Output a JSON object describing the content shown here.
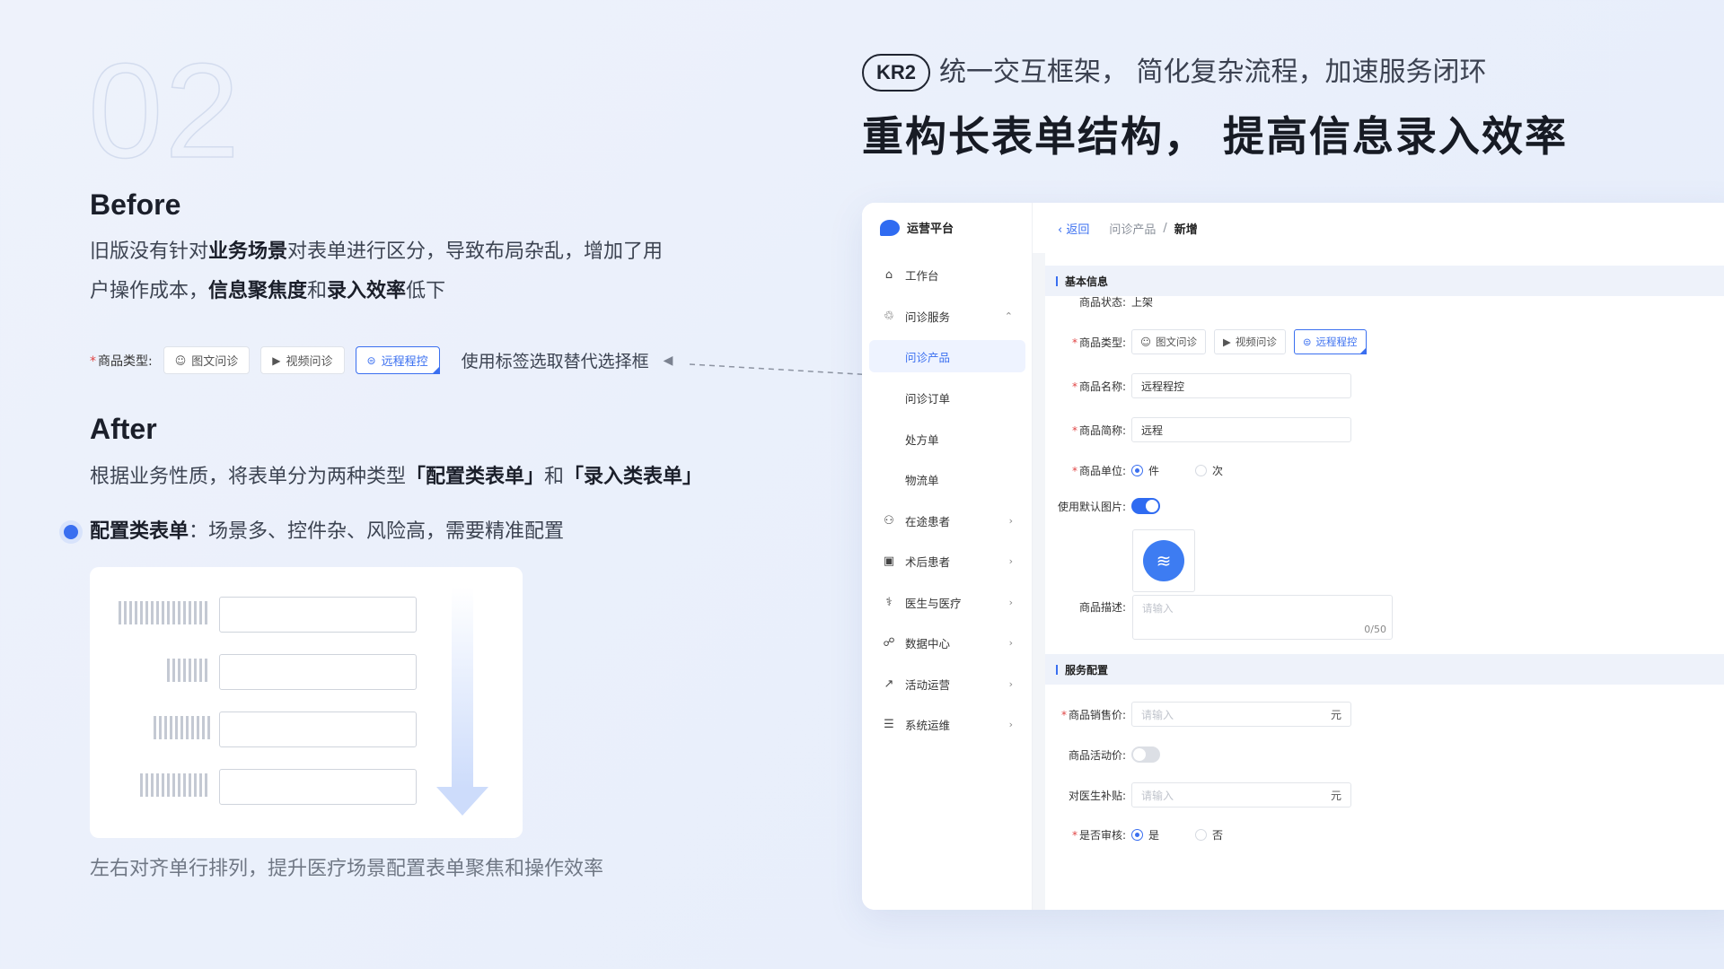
{
  "left": {
    "number": "02",
    "before": {
      "title": "Before",
      "line1_a": "旧版没有针对",
      "line1_b": "业务场景",
      "line1_c": "对表单进行区分，导致布局杂乱，增加了用",
      "line2_a": "户操作成本，",
      "line2_b": "信息聚焦度",
      "line2_c": "和",
      "line2_d": "录入效率",
      "line2_e": "低下"
    },
    "demo": {
      "label": "商品类型:",
      "tags": [
        "图文问诊",
        "视频问诊",
        "远程程控"
      ],
      "selected_index": 2,
      "note": "使用标签选取替代选择框"
    },
    "after": {
      "title": "After",
      "line_a": "根据业务性质，将表单分为两种类型",
      "line_b": "「配置类表单」",
      "line_c": "和",
      "line_d": "「录入类表单」"
    },
    "bullet": {
      "strong": "配置类表单",
      "text": "：场景多、控件杂、风险高，需要精准配置"
    },
    "caption": "左右对齐单行排列，提升医疗场景配置表单聚焦和操作效率"
  },
  "header": {
    "badge": "KR2",
    "subtitle": "统一交互框架，  简化复杂流程，加速服务闭环",
    "headline": "重构长表单结构，  提高信息录入效率"
  },
  "app": {
    "brand": "运营平台",
    "nav": [
      {
        "icon": "home-icon",
        "glyph": "⌂",
        "label": "工作台",
        "chevron": ""
      },
      {
        "icon": "service-icon",
        "glyph": "♲",
        "label": "问诊服务",
        "chevron": "⌃"
      },
      {
        "icon": "",
        "glyph": "",
        "label": "问诊产品",
        "chevron": "",
        "active": true
      },
      {
        "icon": "",
        "glyph": "",
        "label": "问诊订单",
        "chevron": ""
      },
      {
        "icon": "",
        "glyph": "",
        "label": "处方单",
        "chevron": ""
      },
      {
        "icon": "",
        "glyph": "",
        "label": "物流单",
        "chevron": ""
      },
      {
        "icon": "patients-icon",
        "glyph": "⚇",
        "label": "在途患者",
        "chevron": "›"
      },
      {
        "icon": "post-op-icon",
        "glyph": "▣",
        "label": "术后患者",
        "chevron": "›"
      },
      {
        "icon": "doctor-icon",
        "glyph": "⚕",
        "label": "医生与医疗",
        "chevron": "›"
      },
      {
        "icon": "data-icon",
        "glyph": "☍",
        "label": "数据中心",
        "chevron": "›"
      },
      {
        "icon": "chart-icon",
        "glyph": "↗",
        "label": "活动运营",
        "chevron": "›"
      },
      {
        "icon": "doc-icon",
        "glyph": "☰",
        "label": "系统运维",
        "chevron": "›"
      }
    ],
    "topbar": {
      "back": "返回",
      "crumb": "问诊产品",
      "sep": "/",
      "current": "新增"
    },
    "sections": {
      "basic": "基本信息",
      "service": "服务配置"
    },
    "form": {
      "status_label": "商品状态:",
      "status_value": "上架",
      "type_label": "商品类型:",
      "type_tags": [
        "图文问诊",
        "视频问诊",
        "远程程控"
      ],
      "name_label": "商品名称:",
      "name_value": "远程程控",
      "short_label": "商品简称:",
      "short_value": "远程",
      "unit_label": "商品单位:",
      "unit_options": [
        "件",
        "次"
      ],
      "default_img_label": "使用默认图片:",
      "desc_label": "商品描述:",
      "desc_placeholder": "请输入",
      "desc_count": "0/50",
      "price_label": "商品销售价:",
      "price_placeholder": "请输入",
      "price_unit": "元",
      "promo_label": "商品活动价:",
      "subsidy_label": "对医生补贴:",
      "subsidy_placeholder": "请输入",
      "subsidy_unit": "元",
      "review_label": "是否审核:",
      "review_options": [
        "是",
        "否"
      ]
    }
  },
  "colors": {
    "accent": "#3a6ff0",
    "background": "#eef2fb"
  }
}
